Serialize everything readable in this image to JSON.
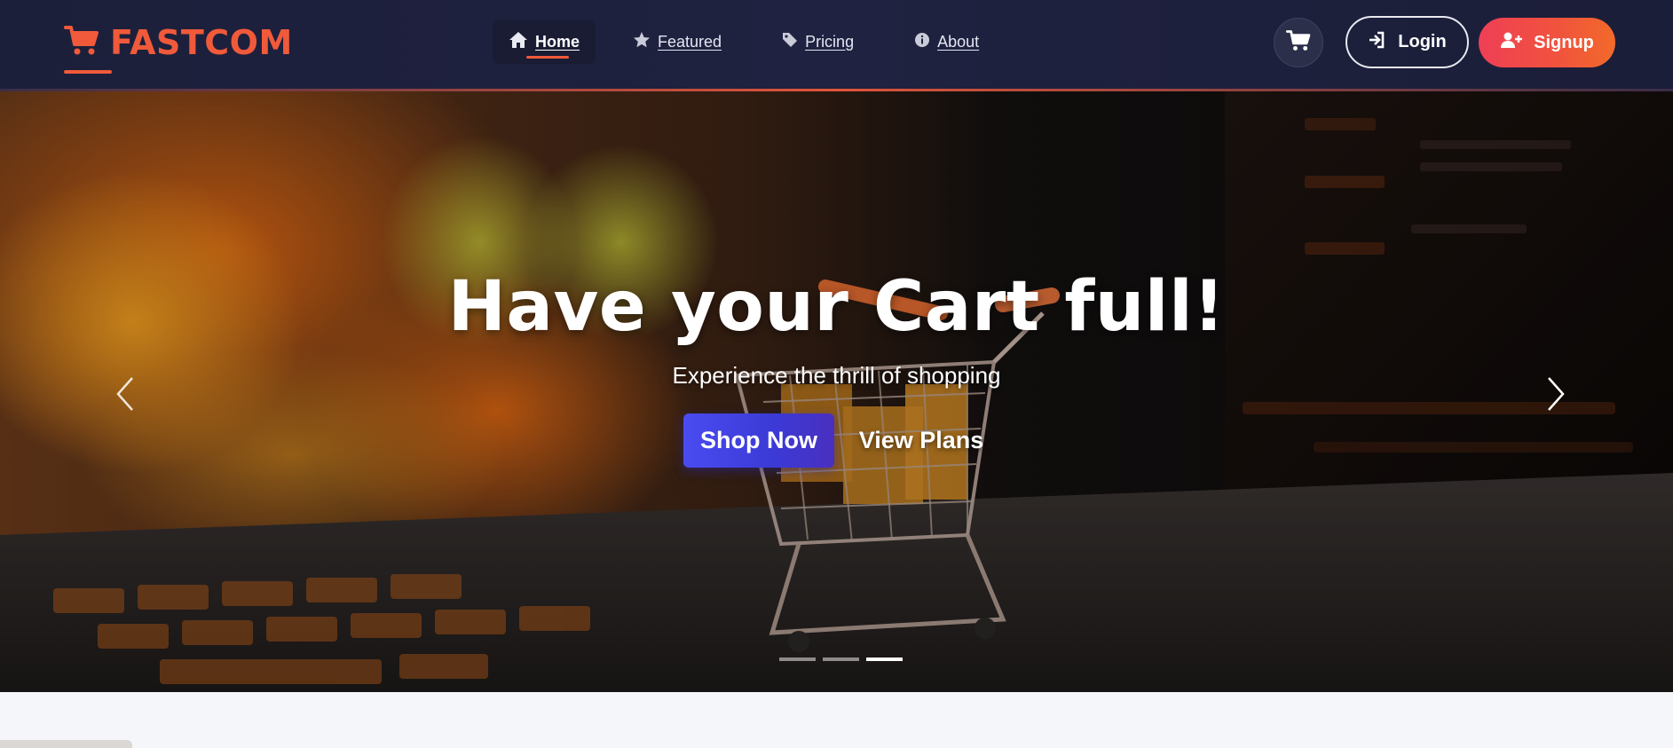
{
  "brand": {
    "name": "FASTCOM",
    "color": "#f05a3a",
    "icon": "shopping-cart-icon"
  },
  "nav": {
    "items": [
      {
        "label": "Home",
        "icon": "home-icon",
        "active": true
      },
      {
        "label": "Featured",
        "icon": "star-icon",
        "active": false
      },
      {
        "label": "Pricing",
        "icon": "tag-icon",
        "active": false
      },
      {
        "label": "About",
        "icon": "info-circle-icon",
        "active": false
      }
    ]
  },
  "actions": {
    "cart_icon": "shopping-cart-icon",
    "login_label": "Login",
    "login_icon": "sign-in-icon",
    "signup_label": "Signup",
    "signup_icon": "user-plus-icon"
  },
  "hero": {
    "title": "Have your Cart full!",
    "subtitle": "Experience the thrill of shopping",
    "primary_button": "Shop Now",
    "secondary_button": "View Plans",
    "prev_icon": "chevron-left-icon",
    "next_icon": "chevron-right-icon",
    "slide_count": 3,
    "active_slide": 3
  },
  "colors": {
    "navbar_bg": "#1f2240",
    "accent": "#f05a3a",
    "signup_gradient_start": "#ef3f56",
    "signup_gradient_end": "#f36a2a",
    "shop_button": "#4a4cf0"
  }
}
